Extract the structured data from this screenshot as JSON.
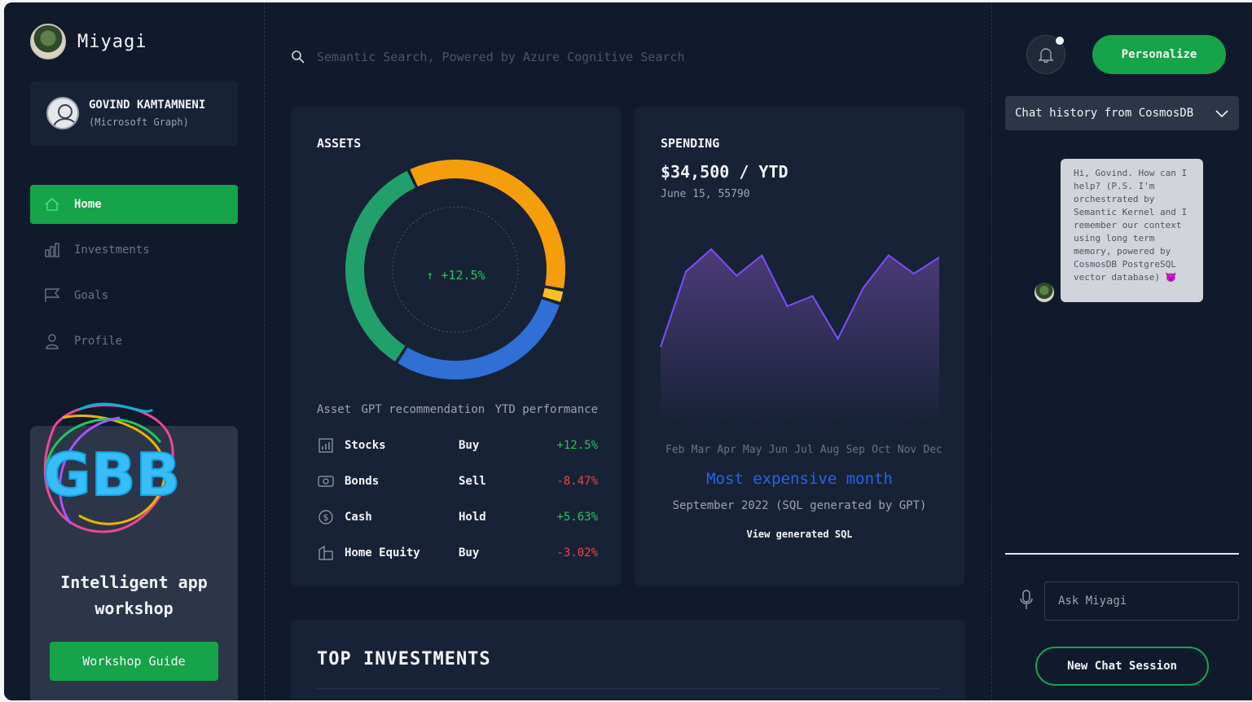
{
  "brand": {
    "name": "Miyagi"
  },
  "user": {
    "name": "GOVIND KAMTAMNENI",
    "source": "(Microsoft Graph)"
  },
  "nav": {
    "items": [
      {
        "label": "Home",
        "icon": "home-icon",
        "active": true
      },
      {
        "label": "Investments",
        "icon": "bar-chart-icon",
        "active": false
      },
      {
        "label": "Goals",
        "icon": "flag-icon",
        "active": false
      },
      {
        "label": "Profile",
        "icon": "user-icon",
        "active": false
      }
    ]
  },
  "promo": {
    "title_line1": "Intelligent app",
    "title_line2": "workshop",
    "button_label": "Workshop Guide",
    "logo_text": "GBB"
  },
  "search": {
    "placeholder": "Semantic Search, Powered by Azure Cognitive Search"
  },
  "assets": {
    "title": "ASSETS",
    "center_label": "↑ +12.5%",
    "headers": {
      "col1": "Asset",
      "col2": "GPT recommendation",
      "col3": "YTD performance"
    },
    "rows": [
      {
        "name": "Stocks",
        "rec": "Buy",
        "perf": "+12.5%",
        "icon": "stocks-icon"
      },
      {
        "name": "Bonds",
        "rec": "Sell",
        "perf": "-8.47%",
        "icon": "bonds-icon"
      },
      {
        "name": "Cash",
        "rec": "Hold",
        "perf": "+5.63%",
        "icon": "cash-icon"
      },
      {
        "name": "Home Equity",
        "rec": "Buy",
        "perf": "-3.02%",
        "icon": "home-equity-icon"
      }
    ],
    "donut": [
      {
        "label": "orange",
        "value": 0.35,
        "color": "#f59e0b"
      },
      {
        "label": "yellow",
        "value": 0.02,
        "color": "#fbbf24"
      },
      {
        "label": "blue",
        "value": 0.29,
        "color": "#2f6fd6"
      },
      {
        "label": "green",
        "value": 0.34,
        "color": "#22a06b"
      }
    ]
  },
  "spending": {
    "title": "SPENDING",
    "amount": "$34,500 / YTD",
    "date": "June 15, 55790",
    "months": [
      "Feb",
      "Mar",
      "Apr",
      "May",
      "Jun",
      "Jul",
      "Aug",
      "Sep",
      "Oct",
      "Nov",
      "Dec"
    ],
    "series": [
      0.38,
      0.75,
      0.86,
      0.73,
      0.83,
      0.58,
      0.63,
      0.42,
      0.67,
      0.83,
      0.74,
      0.82
    ],
    "highlight_title": "Most expensive month",
    "highlight_sub": "September 2022 (SQL generated by GPT)",
    "link": "View generated SQL"
  },
  "investments": {
    "title": "TOP INVESTMENTS"
  },
  "chat": {
    "personalize_label": "Personalize",
    "history_label": "Chat history from CosmosDB",
    "message": "Hi, Govind. How can I help? (P.S. I'm orchestrated by Semantic Kernel and I remember our context using long term memory, powered by CosmosDB PostgreSQL vector database) 😈",
    "input_placeholder": "Ask Miyagi",
    "new_session_label": "New Chat Session"
  },
  "colors": {
    "accent": "#17a34a",
    "positive": "#22c55e",
    "negative": "#ef4444",
    "link_blue": "#2563eb",
    "chart_line": "#7c4dff"
  }
}
